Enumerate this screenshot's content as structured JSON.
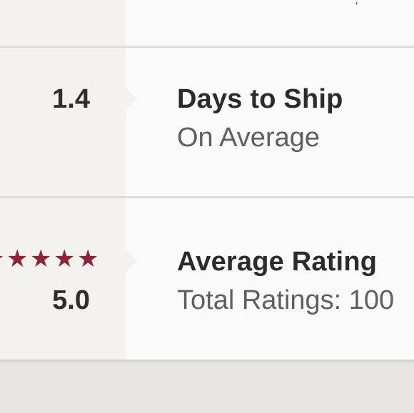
{
  "shipping": {
    "value": "1.4",
    "title": "Days to Ship",
    "subtitle": "On Average"
  },
  "rating": {
    "value": "5.0",
    "stars_filled": 5,
    "title": "Average Rating",
    "subtitle": "Total Ratings: 100"
  },
  "colors": {
    "star": "#8f2438",
    "left_column_bg": "#f4f2ee",
    "panel_bg": "#fafafa",
    "divider": "#dedede"
  },
  "icons": {
    "star": "star-icon"
  }
}
